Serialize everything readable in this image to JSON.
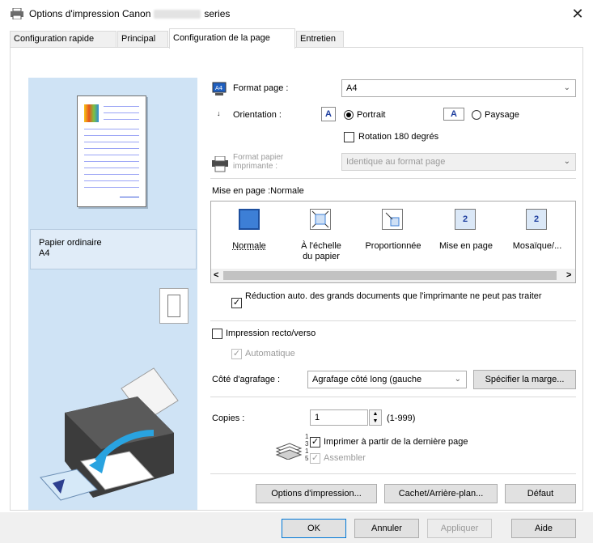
{
  "window": {
    "title_prefix": "Options d'impression Canon",
    "title_suffix": "series"
  },
  "tabs": [
    {
      "label": "Configuration rapide"
    },
    {
      "label": "Principal"
    },
    {
      "label": "Configuration de la page"
    },
    {
      "label": "Entretien"
    }
  ],
  "preview": {
    "paper_type": "Papier ordinaire",
    "paper_size": "A4"
  },
  "page_setup": {
    "format_label": "Format page :",
    "format_value": "A4",
    "orientation_label": "Orientation :",
    "portrait": "Portrait",
    "landscape": "Paysage",
    "rotate": "Rotation 180 degrés",
    "printer_format_label": "Format papier imprimante :",
    "printer_format_value": "Identique au format page"
  },
  "layout": {
    "heading": "Mise en page :Normale",
    "options": [
      {
        "label": "Normale"
      },
      {
        "label": "À l'échelle du papier"
      },
      {
        "label": "Proportionnée"
      },
      {
        "label": "Mise en page"
      },
      {
        "label": "Mosaïque/..."
      }
    ],
    "scroll_left": "<",
    "scroll_right": ">",
    "auto_reduce": "Réduction auto. des grands documents que l'imprimante ne peut pas traiter"
  },
  "duplex": {
    "label": "Impression recto/verso",
    "auto": "Automatique",
    "stapling_label": "Côté d'agrafage :",
    "stapling_value": "Agrafage côté long (gauche",
    "margin_button": "Spécifier la marge..."
  },
  "copies": {
    "label": "Copies :",
    "value": "1",
    "range": "(1-999)",
    "last_page": "Imprimer à partir de la dernière page",
    "collate": "Assembler"
  },
  "footer_buttons": {
    "print_options": "Options d'impression...",
    "stamp": "Cachet/Arrière-plan...",
    "default": "Défaut"
  },
  "dialog_buttons": {
    "ok": "OK",
    "cancel": "Annuler",
    "apply": "Appliquer",
    "help": "Aide"
  }
}
